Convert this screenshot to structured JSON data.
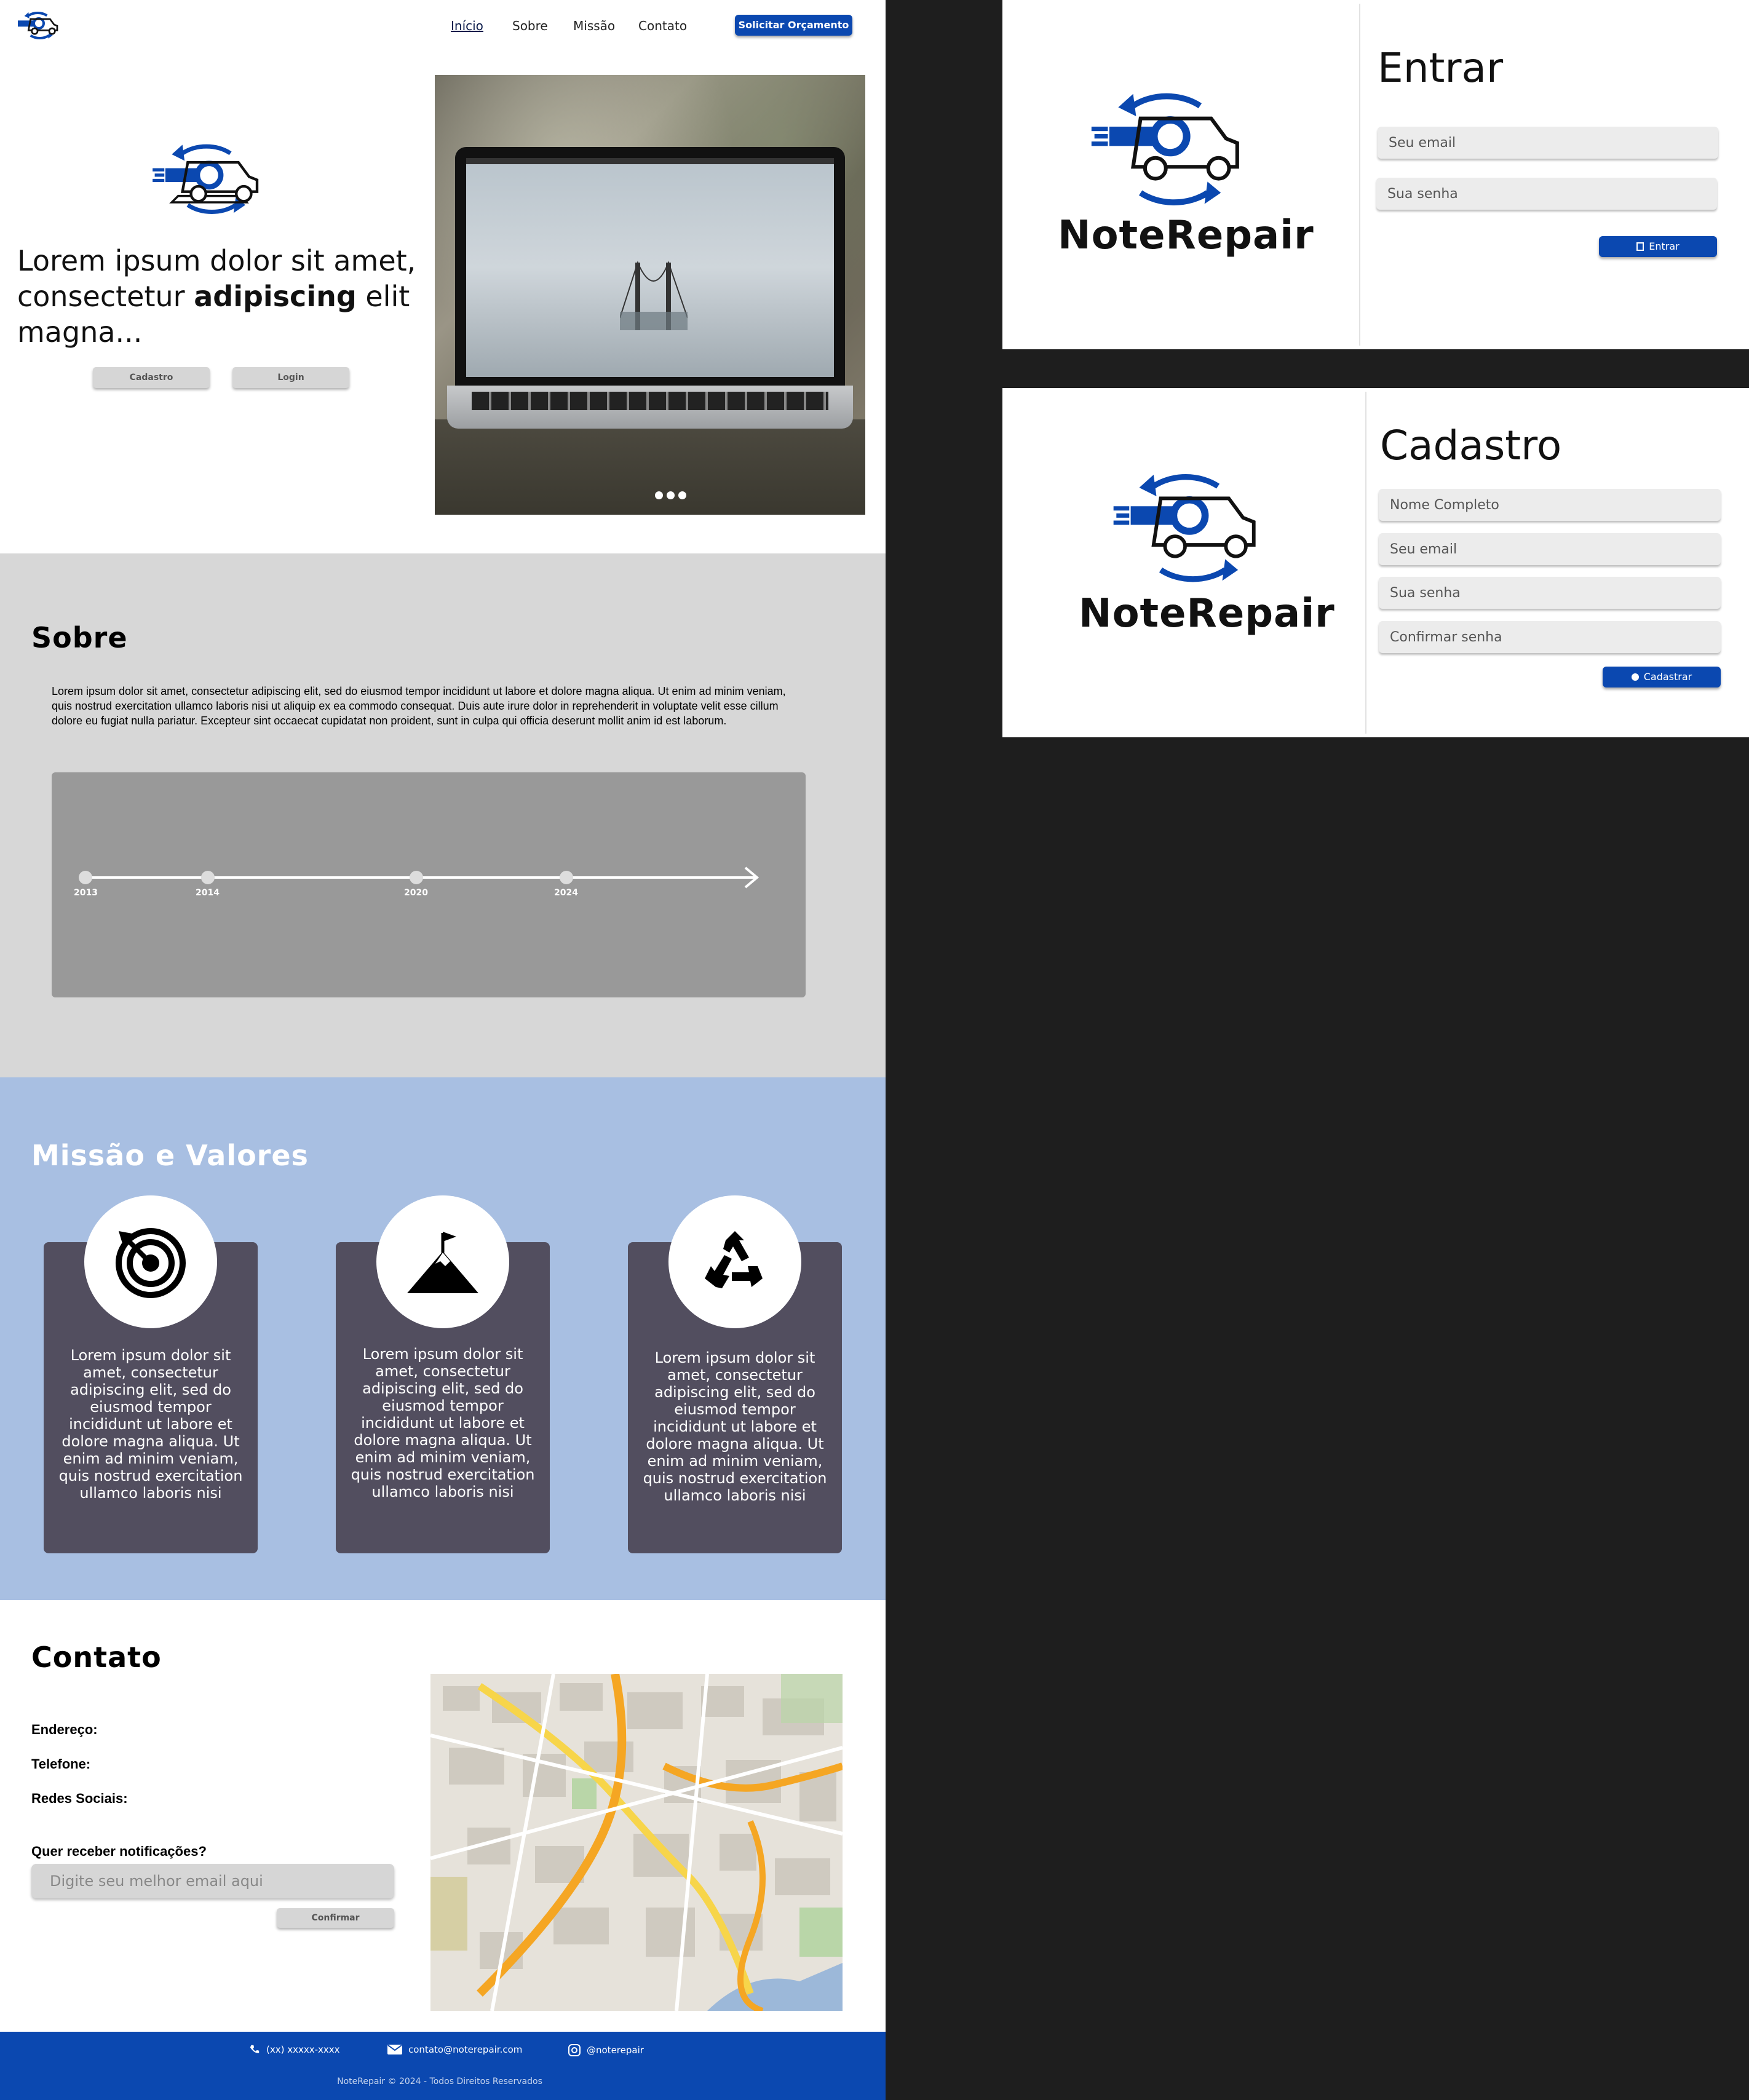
{
  "nav": {
    "links": [
      "Início",
      "Sobre",
      "Missão",
      "Contato"
    ],
    "cta": "Solicitar Orçamento"
  },
  "hero": {
    "text_before": "Lorem ipsum dolor sit amet, consectetur ",
    "text_bold": "adipiscing",
    "text_after": " elit magna...",
    "btn_cadastro": "Cadastro",
    "btn_login": "Login",
    "carousel_dots": 3
  },
  "sobre": {
    "title": "Sobre",
    "paragraph": "Lorem ipsum dolor sit amet, consectetur adipiscing elit, sed do eiusmod tempor incididunt ut labore et dolore magna aliqua. Ut enim ad minim veniam, quis nostrud exercitation ullamco laboris nisi ut aliquip ex ea commodo consequat. Duis aute irure dolor in reprehenderit in voluptate velit esse cillum dolore eu fugiat nulla pariatur. Excepteur sint occaecat cupidatat non proident, sunt in culpa qui officia deserunt mollit anim id est laborum.",
    "timeline": [
      "2013",
      "2014",
      "2020",
      "2024"
    ]
  },
  "missao": {
    "title": "Missão e Valores",
    "cards": [
      {
        "icon": "target-icon",
        "text": "Lorem ipsum dolor sit amet, consectetur adipiscing elit, sed do eiusmod tempor incididunt ut labore et dolore magna aliqua. Ut enim ad minim veniam, quis nostrud exercitation ullamco laboris nisi"
      },
      {
        "icon": "mountain-flag-icon",
        "text": "Lorem ipsum dolor sit amet, consectetur adipiscing elit, sed do eiusmod tempor incididunt ut labore et dolore magna aliqua. Ut enim ad minim veniam, quis nostrud exercitation ullamco laboris nisi"
      },
      {
        "icon": "recycle-icon",
        "text": "Lorem ipsum dolor sit amet, consectetur adipiscing elit, sed do eiusmod tempor incididunt ut labore et dolore magna aliqua. Ut enim ad minim veniam, quis nostrud exercitation ullamco laboris nisi"
      }
    ]
  },
  "contato": {
    "title": "Contato",
    "endereco": "Endereço:",
    "telefone": "Telefone:",
    "redes": "Redes Sociais:",
    "newsletter_label": "Quer receber notificações?",
    "email_placeholder": "Digite seu melhor email aqui",
    "confirm": "Confirmar"
  },
  "footer": {
    "phone": "(xx) xxxxx-xxxx",
    "email": "contato@noterepair.com",
    "instagram": "@noterepair",
    "copyright": "NoteRepair © 2024 - Todos Direitos Reservados"
  },
  "login_modal": {
    "brand": "NoteRepair",
    "title": "Entrar",
    "email_placeholder": "Seu email",
    "password_placeholder": "Sua senha",
    "submit": "Entrar"
  },
  "signup_modal": {
    "brand": "NoteRepair",
    "title": "Cadastro",
    "name_placeholder": "Nome Completo",
    "email_placeholder": "Seu email",
    "password_placeholder": "Sua senha",
    "confirm_placeholder": "Confirmar senha",
    "submit": "Cadastrar"
  },
  "colors": {
    "brand_blue": "#0b48b0",
    "sobre_bg": "#d7d7d7",
    "missao_bg": "#a8bfe2",
    "card_bg": "#524e5f",
    "timeline_bg": "#999999",
    "outer_bg": "#1e1e1e"
  }
}
